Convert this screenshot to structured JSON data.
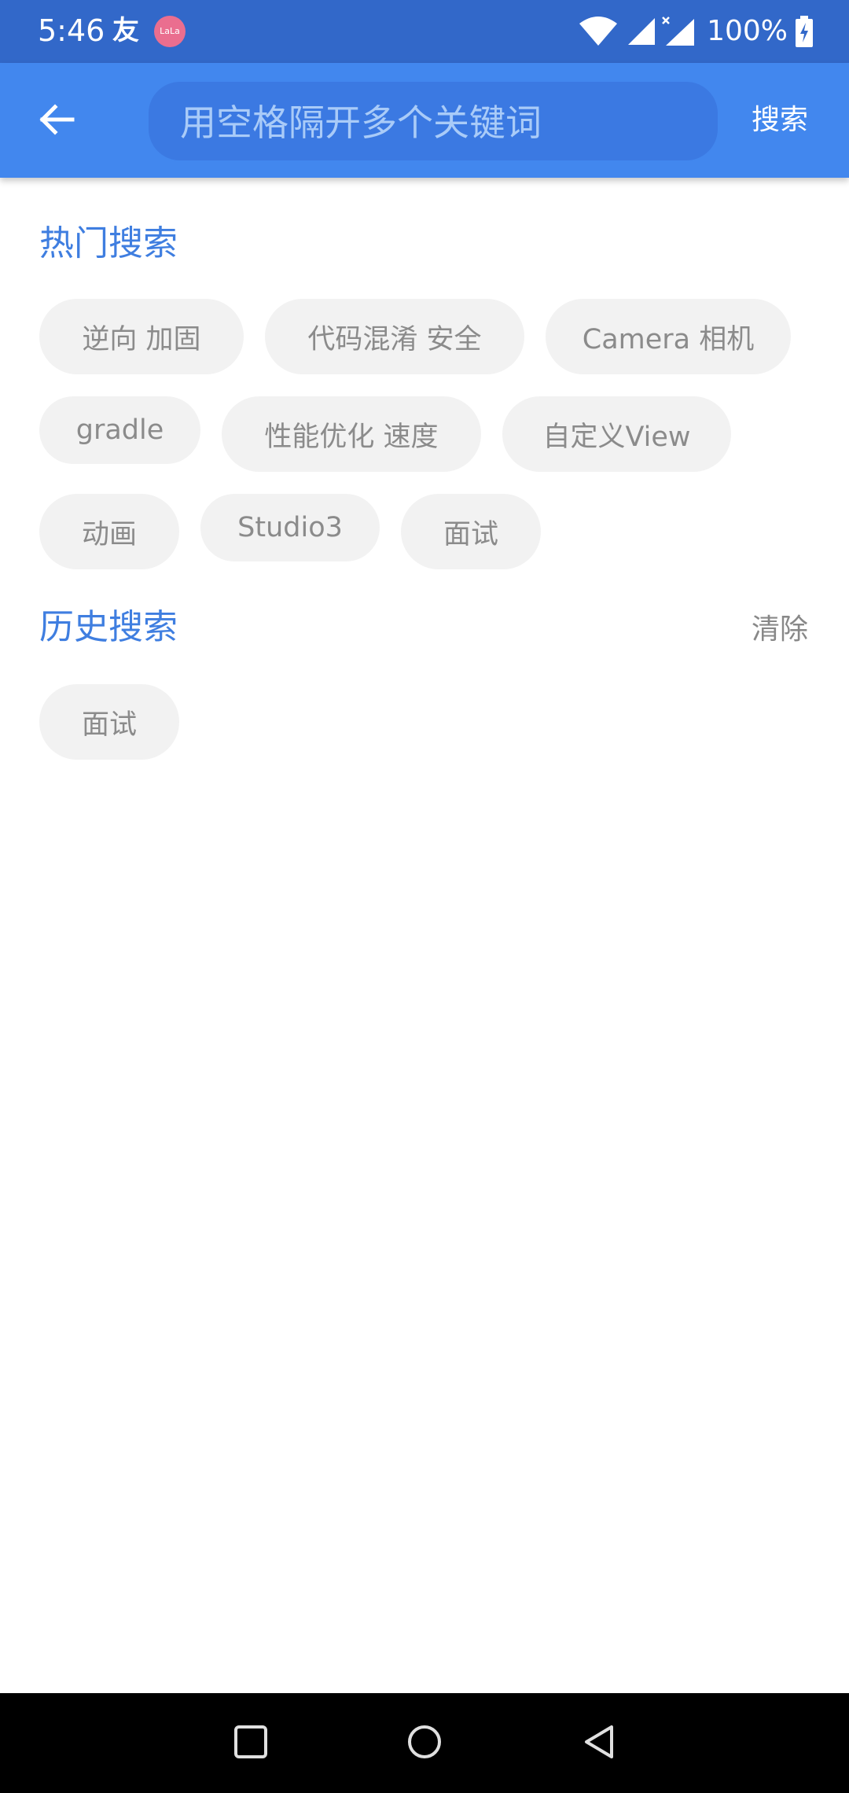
{
  "status_bar": {
    "time": "5:46",
    "notification_icon_1": "友",
    "notification_icon_2": "LaLa",
    "battery_percent": "100%",
    "icons": [
      "wifi-icon",
      "signal-icon",
      "signal-no-data-icon",
      "battery-charging-icon"
    ]
  },
  "app_bar": {
    "back_icon": "arrow-left-icon",
    "search_placeholder": "用空格隔开多个关键词",
    "search_value": "",
    "search_label": "搜索"
  },
  "hot_search": {
    "title": "热门搜索",
    "tags": [
      "逆向 加固",
      "代码混淆 安全",
      "Camera 相机",
      "gradle",
      "性能优化 速度",
      "自定义View",
      "动画",
      "Studio3",
      "面试"
    ]
  },
  "history_search": {
    "title": "历史搜索",
    "clear_label": "清除",
    "tags": [
      "面试"
    ]
  },
  "nav_bar": {
    "buttons": [
      "recents-square-icon",
      "home-circle-icon",
      "back-triangle-icon"
    ]
  },
  "colors": {
    "status_bar": "#3268c9",
    "app_bar": "#4287ee",
    "accent_text": "#3f7ee0",
    "chip_bg": "#f2f2f2",
    "chip_text": "#8b8b8b"
  }
}
